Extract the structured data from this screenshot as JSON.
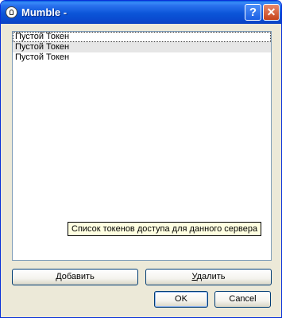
{
  "window": {
    "title": "Mumble -",
    "help_glyph": "?",
    "close_glyph": "✕"
  },
  "tokens": {
    "items": [
      {
        "label": "Пустой Токен"
      },
      {
        "label": "Пустой Токен"
      },
      {
        "label": "Пустой Токен"
      }
    ],
    "tooltip": "Список токенов доступа для данного сервера"
  },
  "buttons": {
    "add_accel": "Д",
    "add_rest": "обавить",
    "delete_accel": "У",
    "delete_rest": "далить",
    "ok": "OK",
    "cancel": "Cancel"
  },
  "colors": {
    "titlebar": "#0b55d8",
    "dialog_bg": "#ece9d8",
    "tooltip_bg": "#ffffe1"
  }
}
